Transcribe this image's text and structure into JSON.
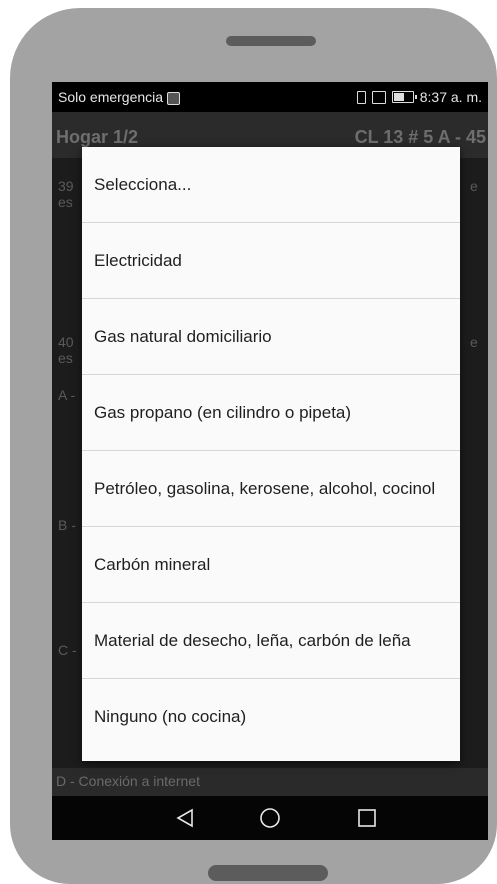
{
  "status_bar": {
    "carrier": "Solo emergencia",
    "time": "8:37 a. m.",
    "icons": [
      "notification-icon",
      "vibrate-icon",
      "screen-rotation-icon",
      "battery-icon"
    ]
  },
  "app_bar": {
    "title": "Hogar 1/2",
    "address": "CL 13 # 5 A - 45"
  },
  "background": {
    "q39_prefix": "39",
    "q39_line2": "es",
    "q39_suffix": "e",
    "q40_prefix": "40",
    "q40_line2": "es",
    "q40_suffix": "e",
    "item_a": "A -",
    "item_b": "B -",
    "item_c": "C -",
    "item_d": "D - Conexión a internet"
  },
  "dialog": {
    "options": [
      "Selecciona...",
      "Electricidad",
      "Gas natural domiciliario",
      "Gas propano (en cilindro o pipeta)",
      "Petróleo, gasolina, kerosene, alcohol, cocinol",
      "Carbón mineral",
      "Material de desecho, leña, carbón de leña",
      "Ninguno (no cocina)"
    ]
  },
  "nav_bar": {
    "buttons": [
      "back-icon",
      "home-icon",
      "recents-icon"
    ]
  },
  "colors": {
    "phone_body": "#a3a3a3",
    "screen_dim": "#1c1c1c",
    "dialog_bg": "#fafafa",
    "divider": "#d6d6d6"
  }
}
